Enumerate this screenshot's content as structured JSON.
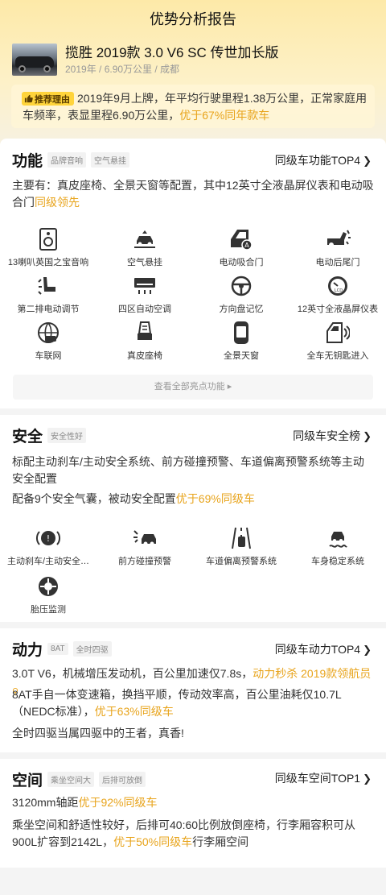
{
  "page_title": "优势分析报告",
  "car": {
    "name": "揽胜 2019款 3.0 V6 SC 传世加长版",
    "meta": "2019年 / 6.90万公里 / 成都"
  },
  "reason": {
    "badge": "推荐理由",
    "text": "2019年9月上牌，年平均行驶里程1.38万公里，正常家庭用车频率，表显里程6.90万公里，",
    "highlight": "优于67%同年款车"
  },
  "features": {
    "title": "功能",
    "tags": [
      "品牌音响",
      "空气悬挂"
    ],
    "link": "同级车功能TOP4",
    "desc": "主要有：真皮座椅、全景天窗等配置，其中12英寸全液晶屏仪表和电动吸合门",
    "desc_hl": "同级领先",
    "items": [
      {
        "label": "13喇叭英国之宝音响",
        "icon": "speaker-icon"
      },
      {
        "label": "空气悬挂",
        "icon": "air-suspension-icon"
      },
      {
        "label": "电动吸合门",
        "icon": "soft-close-door-icon"
      },
      {
        "label": "电动后尾门",
        "icon": "power-tailgate-icon"
      },
      {
        "label": "第二排电动调节",
        "icon": "seat-adjust-icon"
      },
      {
        "label": "四区自动空调",
        "icon": "air-conditioner-icon"
      },
      {
        "label": "方向盘记忆",
        "icon": "steering-wheel-icon"
      },
      {
        "label": "12英寸全液晶屏仪表",
        "icon": "lcd-gauge-icon"
      },
      {
        "label": "车联网",
        "icon": "connected-car-icon"
      },
      {
        "label": "真皮座椅",
        "icon": "leather-seat-icon"
      },
      {
        "label": "全景天窗",
        "icon": "panoramic-sunroof-icon"
      },
      {
        "label": "全车无钥匙进入",
        "icon": "keyless-entry-icon"
      }
    ],
    "more": "查看全部亮点功能 ▸"
  },
  "safety": {
    "title": "安全",
    "tags": [
      "安全性好"
    ],
    "link": "同级车安全榜",
    "desc1": "标配主动刹车/主动安全系统、前方碰撞预警、车道偏离预警系统等主动安全配置",
    "desc2": "配备9个安全气囊，被动安全配置",
    "desc2_hl": "优于69%同级车",
    "items": [
      {
        "label": "主动刹车/主动安全…",
        "icon": "brake-icon"
      },
      {
        "label": "前方碰撞预警",
        "icon": "collision-warning-icon"
      },
      {
        "label": "车道偏离预警系统",
        "icon": "lane-departure-icon"
      },
      {
        "label": "车身稳定系统",
        "icon": "stability-icon"
      },
      {
        "label": "胎压监测",
        "icon": "tire-pressure-icon"
      }
    ]
  },
  "power": {
    "title": "动力",
    "tags": [
      "8AT",
      "全时四驱"
    ],
    "link": "同级车动力TOP4",
    "line1": "3.0T V6，机械增压发动机，百公里加速仅7.8s，",
    "line1_hl": "动力秒杀 2019款领航员",
    "line2": "8AT手自一体变速箱，换挡平顺，传动效率高，百公里油耗仅10.7L（NEDC标准），",
    "line2_hl": "优于63%同级车",
    "line3": "全时四驱当属四驱中的王者，真香!"
  },
  "space": {
    "title": "空间",
    "tags": [
      "乘坐空间大",
      "后排可放倒"
    ],
    "link": "同级车空间TOP1",
    "line1": "3120mm轴距",
    "line1_hl": "优于92%同级车",
    "line2": "乘坐空间和舒适性较好，后排可40:60比例放倒座椅，行李厢容积可从900L扩容到2142L，",
    "line2_hl": "优于50%同级车",
    "line2_tail": "行李厢空间"
  },
  "colors": {
    "accent": "#e8a41c",
    "badge": "#ffd43b"
  }
}
